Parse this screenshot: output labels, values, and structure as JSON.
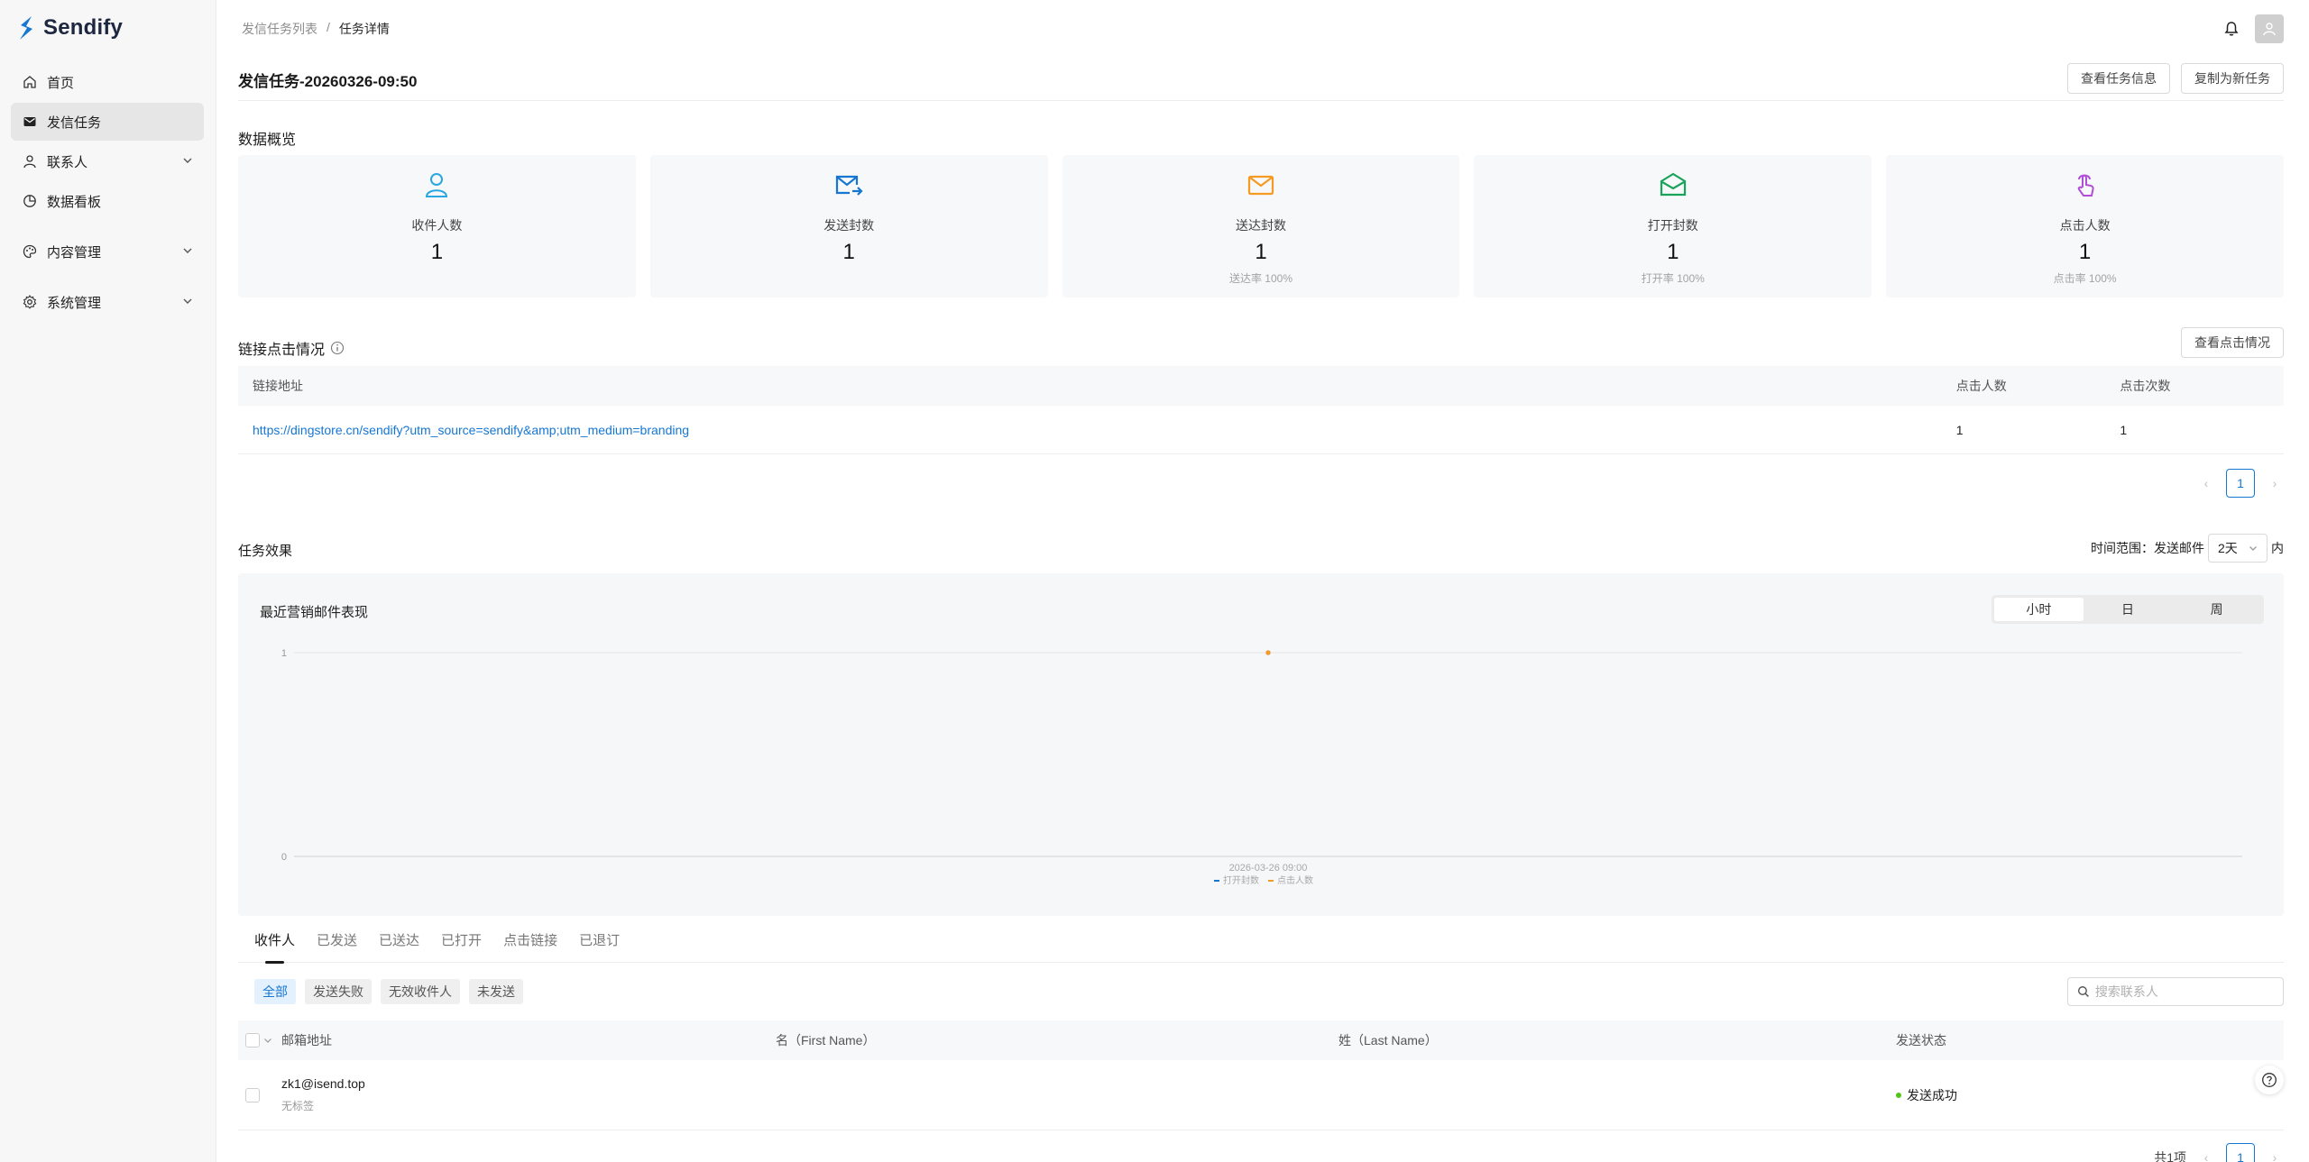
{
  "app": {
    "name": "Sendify"
  },
  "sidebar": {
    "items": [
      {
        "label": "首页",
        "icon": "home-icon"
      },
      {
        "label": "发信任务",
        "icon": "mail-icon"
      },
      {
        "label": "联系人",
        "icon": "user-icon"
      },
      {
        "label": "数据看板",
        "icon": "pie-chart-icon"
      },
      {
        "label": "内容管理",
        "icon": "palette-icon"
      },
      {
        "label": "系统管理",
        "icon": "gear-icon"
      }
    ]
  },
  "breadcrumb": {
    "parent": "发信任务列表",
    "separator": "/",
    "current": "任务详情"
  },
  "header": {
    "title": "发信任务-20260326-09:50",
    "view_info_label": "查看任务信息",
    "copy_label": "复制为新任务"
  },
  "overview": {
    "title": "数据概览",
    "stats": [
      {
        "label": "收件人数",
        "value": "1",
        "sub": "",
        "color": "#2aa6e0"
      },
      {
        "label": "发送封数",
        "value": "1",
        "sub": "",
        "color": "#1677d2"
      },
      {
        "label": "送达封数",
        "value": "1",
        "sub": "送达率 100%",
        "color": "#f59a23"
      },
      {
        "label": "打开封数",
        "value": "1",
        "sub": "打开率 100%",
        "color": "#1aa35a"
      },
      {
        "label": "点击人数",
        "value": "1",
        "sub": "点击率 100%",
        "color": "#b04fd6"
      }
    ]
  },
  "links": {
    "title": "链接点击情况",
    "view_label": "查看点击情况",
    "columns": [
      "链接地址",
      "点击人数",
      "点击次数"
    ],
    "rows": [
      {
        "url": "https://dingstore.cn/sendify?utm_source=sendify&amp;utm_medium=branding",
        "clickers": "1",
        "clicks": "1"
      }
    ],
    "page": "1"
  },
  "effect": {
    "title": "任务效果",
    "range_label": "时间范围：发送邮件",
    "range_value": "2天",
    "range_suffix": "内"
  },
  "chart_data": {
    "type": "line",
    "title": "最近营销邮件表现",
    "granularity_options": [
      "小时",
      "日",
      "周"
    ],
    "granularity_selected": "小时",
    "x": [
      "2026-03-26 09:00"
    ],
    "series": [
      {
        "name": "打开封数",
        "values": [
          1
        ],
        "color": "#1677d2"
      },
      {
        "name": "点击人数",
        "values": [
          1
        ],
        "color": "#f59a23"
      }
    ],
    "ylim": [
      0,
      1
    ],
    "y_ticks": [
      "1",
      "0"
    ],
    "legend": "bottom-center"
  },
  "recipients": {
    "tabs": [
      "收件人",
      "已发送",
      "已送达",
      "已打开",
      "点击链接",
      "已退订"
    ],
    "filters": [
      "全部",
      "发送失败",
      "无效收件人",
      "未发送"
    ],
    "search_placeholder": "搜索联系人",
    "columns": [
      "邮箱地址",
      "名（First Name）",
      "姓（Last Name）",
      "发送状态"
    ],
    "rows": [
      {
        "email": "zk1@isend.top",
        "tag": "无标签",
        "first": "",
        "last": "",
        "status": "发送成功"
      }
    ],
    "total": "共1项",
    "page": "1"
  }
}
